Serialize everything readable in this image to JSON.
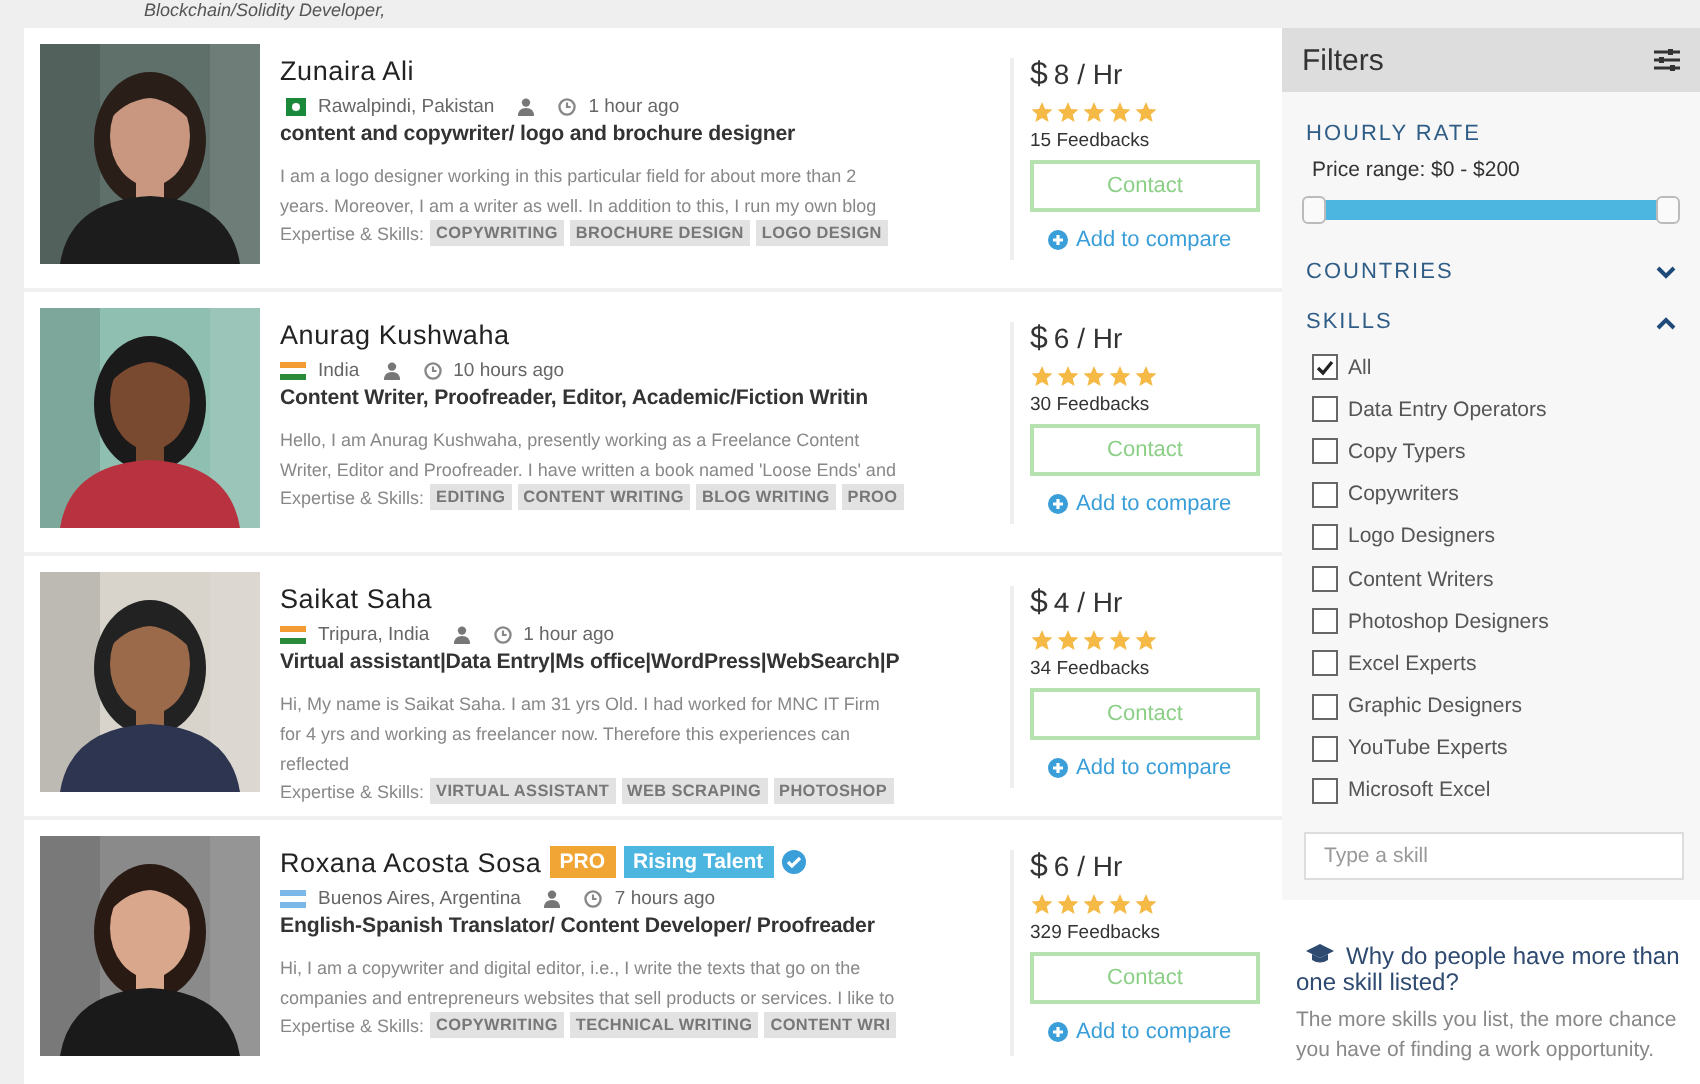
{
  "top_text": "Blockchain/Solidity Developer,",
  "freelancers": [
    {
      "name": "Zunaira Ali",
      "location": "Rawalpindi, Pakistan",
      "posted": "1 hour ago",
      "title": "content and copywriter/ logo and brochure designer",
      "description": "I am a logo designer working in this particular field for about more than 2 years. Moreover, I am a writer as well. In addition to this, I run my own blog",
      "skills_label": "Expertise & Skills:",
      "skills": [
        "COPYWRITING",
        "BROCHURE DESIGN",
        "LOGO DESIGN"
      ],
      "rate": "8 / Hr",
      "currency": "$",
      "stars": 5,
      "feedbacks": "15 Feedbacks",
      "contact": "Contact",
      "compare": "Add to compare"
    },
    {
      "name": "Anurag Kushwaha",
      "location": "India",
      "posted": "10 hours ago",
      "title": "Content Writer, Proofreader, Editor, Academic/Fiction Writin",
      "description": "Hello, I am Anurag Kushwaha, presently working as a Freelance Content Writer, Editor and Proofreader. I have written a book named 'Loose Ends' and",
      "skills_label": "Expertise & Skills:",
      "skills": [
        "EDITING",
        "CONTENT WRITING",
        "BLOG WRITING",
        "PROO"
      ],
      "rate": "6 / Hr",
      "currency": "$",
      "stars": 5,
      "feedbacks": "30 Feedbacks",
      "contact": "Contact",
      "compare": "Add to compare"
    },
    {
      "name": "Saikat Saha",
      "location": "Tripura, India",
      "posted": "1 hour ago",
      "title": "Virtual assistant|Data Entry|Ms office|WordPress|WebSearch|P",
      "description": "Hi, My name is Saikat Saha. I am 31 yrs Old. I had worked for MNC IT Firm for 4 yrs and working as freelancer now. Therefore this experiences can reflected",
      "skills_label": "Expertise & Skills:",
      "skills": [
        "VIRTUAL ASSISTANT",
        "WEB SCRAPING",
        "PHOTOSHOP"
      ],
      "rate": "4 / Hr",
      "currency": "$",
      "stars": 5,
      "feedbacks": "34 Feedbacks",
      "contact": "Contact",
      "compare": "Add to compare"
    },
    {
      "name": "Roxana Acosta Sosa",
      "badges": [
        {
          "text": "PRO",
          "kind": "pro"
        },
        {
          "text": "Rising Talent",
          "kind": "rising"
        }
      ],
      "verified": true,
      "location": "Buenos Aires, Argentina",
      "posted": "7 hours ago",
      "title": "English-Spanish Translator/ Content Developer/ Proofreader",
      "description": "Hi, I am a copywriter and digital editor, i.e., I write the texts that go on the companies and entrepreneurs websites that sell products or services. I like to",
      "skills_label": "Expertise & Skills:",
      "skills": [
        "COPYWRITING",
        "TECHNICAL WRITING",
        "CONTENT WRI"
      ],
      "rate": "6 / Hr",
      "currency": "$",
      "stars": 5,
      "feedbacks": "329 Feedbacks",
      "contact": "Contact",
      "compare": "Add to compare"
    }
  ],
  "filters": {
    "title": "Filters",
    "hourly_rate": {
      "heading": "HOURLY RATE",
      "price_range": "Price range: $0 - $200",
      "level": 1
    },
    "sections": [
      {
        "heading": "COUNTRIES",
        "expanded": false
      },
      {
        "heading": "SKILLS",
        "expanded": true
      }
    ],
    "skills": [
      {
        "label": "All",
        "checked": true
      },
      {
        "label": "Data Entry Operators",
        "checked": false
      },
      {
        "label": "Copy Typers",
        "checked": false
      },
      {
        "label": "Copywriters",
        "checked": false
      },
      {
        "label": "Logo Designers",
        "checked": false
      },
      {
        "label": "Content Writers",
        "checked": false
      },
      {
        "label": "Photoshop Designers",
        "checked": false
      },
      {
        "label": "Excel Experts",
        "checked": false
      },
      {
        "label": "Graphic Designers",
        "checked": false
      },
      {
        "label": "YouTube Experts",
        "checked": false
      },
      {
        "label": "Microsoft Excel",
        "checked": false
      }
    ],
    "skill_search": {
      "placeholder": "Type a skill"
    }
  },
  "info": {
    "heading": "Why do people have more than one skill listed?",
    "text": "The more skills you list, the more chance you have of finding a work opportunity."
  }
}
